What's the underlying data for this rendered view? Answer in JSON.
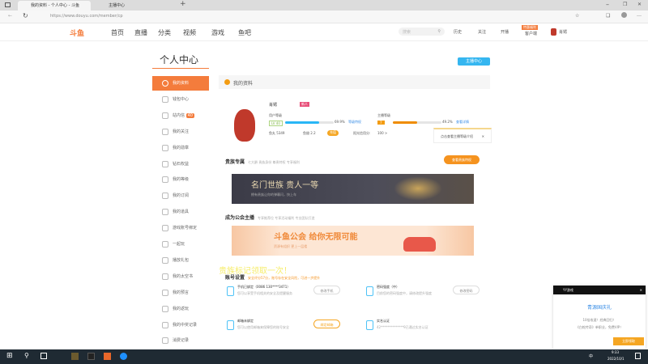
{
  "browser": {
    "tabs": [
      "我的资料 - 个人中心 - 斗鱼",
      "主播中心"
    ],
    "url": "https://www.douyu.com/member/cp"
  },
  "nav": {
    "items": [
      "首页",
      "直播",
      "分类",
      "视频",
      "游戏",
      "鱼吧"
    ],
    "search_placeholder": "搜索",
    "actions": [
      "历史",
      "关注",
      "开播",
      "客户端"
    ],
    "client_badge": "特惠福利",
    "user": "肖锷"
  },
  "page": {
    "title": "个人中心",
    "anchor_center": "主播中心"
  },
  "sidebar": {
    "items": [
      "我的资料",
      "钱包中心",
      "站内信",
      "我的关注",
      "我的勋章",
      "钻石权益",
      "我的等级",
      "我的订阅",
      "我的道具",
      "游戏账号绑定",
      "一起玩",
      "播放礼包",
      "我的太空书",
      "我的预言",
      "我的返玩",
      "我的中奖记录",
      "消费记录"
    ],
    "msg_badge": "40"
  },
  "profile": {
    "header": "我的资料",
    "name": "肖锷",
    "tag": "新人",
    "user_level_label": "用户等级",
    "user_level": "LV 40",
    "user_progress_pct": 69.9,
    "user_progress_text": "69.9%",
    "user_link": "等级特权",
    "anchor_level_label": "主播等级",
    "anchor_level": "7",
    "anchor_progress_pct": 49.2,
    "anchor_progress_text": "49.2%",
    "anchor_link": "查看详情",
    "fishball": "鱼丸 5349",
    "fishbean": "鱼翅 2.2",
    "recharge": "充值",
    "credit_label": "阳光信用分:",
    "credit": "100 >",
    "tooltip": "点击查看主播等级介绍"
  },
  "noble": {
    "title": "贵族专属",
    "subtitle": "七大爵 贵族身份 尊贵特权 专享福利",
    "button": "查看贵族特权",
    "banner_title": "名门世族 贵人一等",
    "banner_sub": "拥有贵族让你的弹幕闪，快上车"
  },
  "guild": {
    "title": "成为公会主播",
    "subtitle": "专享推荐位 专享活动福利 专业团队打造",
    "banner_title": "斗鱼公会 给你无限可能",
    "banner_sub": "资源有组织 更上一层楼"
  },
  "account": {
    "overlay": "贵族标记领取一次！",
    "title": "账号设置",
    "warning": "安全评分57分，账号存在安全风险，可进一步提升",
    "items": [
      {
        "title": "手机已绑定（0086 130****3471）",
        "desc": "您可以享受手机相关的安全及提醒服务",
        "button": "修改手机"
      },
      {
        "title": "密码强度（中）",
        "desc": "目前您的密码强度中，请修改提升强度",
        "button": "修改密码"
      },
      {
        "title": "邮箱未绑定",
        "desc": "您可以使用邮箱来保障您的账号安全",
        "button": "绑定邮箱"
      },
      {
        "title": "实名认证",
        "desc": "42**************9已通过实名认证",
        "button": ""
      }
    ]
  },
  "popup": {
    "app": "YY游戏",
    "title": "青源国庆礼",
    "line1": "10倍攻速！经典回归！",
    "line2": "《白蛇传奇》单职业，免费VIP！",
    "button": "立即领取"
  },
  "taskbar": {
    "time": "9:33",
    "date": "2022/10/1",
    "ime": "中"
  }
}
